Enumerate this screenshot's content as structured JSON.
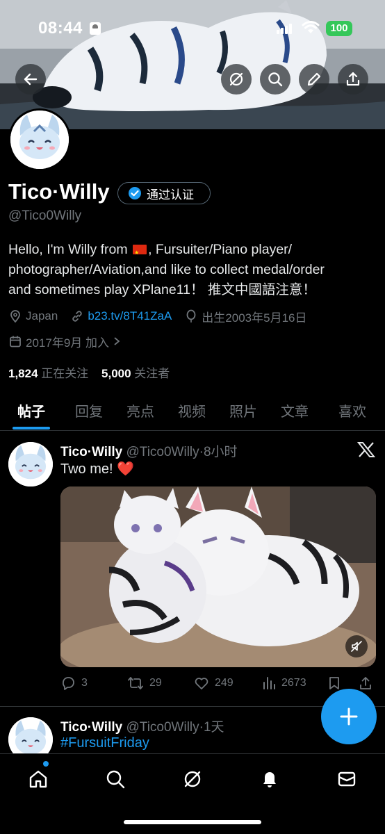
{
  "status_bar": {
    "time": "08:44",
    "battery": "100"
  },
  "header": {
    "back_icon": "arrow-left-icon",
    "actions": [
      "grok-icon",
      "search-icon",
      "edit-icon",
      "share-icon"
    ]
  },
  "profile": {
    "display_name": "Tico·Willy",
    "verified_label": "通过认证",
    "handle": "@Tico0Willy",
    "bio_before_flag": "Hello, I'm Willy from ",
    "bio_after_flag": ", Fursuiter/Piano player/",
    "bio_line2": "photographer/Aviation,and like to collect medal/order",
    "bio_line3": "and sometimes play XPlane11！ 推文中國語注意！",
    "location": "Japan",
    "link": "b23.tv/8T41ZaA",
    "birth": "出生2003年5月16日",
    "joined": "2017年9月 加入 ",
    "following_count": "1,824",
    "following_label": "正在关注",
    "followers_count": "5,000",
    "followers_label": "关注者"
  },
  "tabs": [
    {
      "label": "帖子",
      "active": true
    },
    {
      "label": "回复",
      "active": false
    },
    {
      "label": "亮点",
      "active": false
    },
    {
      "label": "视频",
      "active": false
    },
    {
      "label": "照片",
      "active": false
    },
    {
      "label": "文章",
      "active": false
    },
    {
      "label": "喜欢",
      "active": false
    }
  ],
  "posts": [
    {
      "name": "Tico·Willy",
      "handle_time": "@Tico0Willy·8小时",
      "text": "Two me! ❤️",
      "replies": "3",
      "reposts": "29",
      "likes": "249",
      "views": "2673"
    },
    {
      "name": "Tico·Willy",
      "handle_time": "@Tico0Willy·1天",
      "text": "#FursuitFriday"
    }
  ],
  "bottom_nav": [
    "home-icon",
    "search-icon",
    "grok-icon",
    "notifications-icon",
    "messages-icon"
  ],
  "colors": {
    "accent": "#1d9bf0",
    "background": "#000000",
    "muted": "#71767b",
    "battery": "#34c759"
  }
}
